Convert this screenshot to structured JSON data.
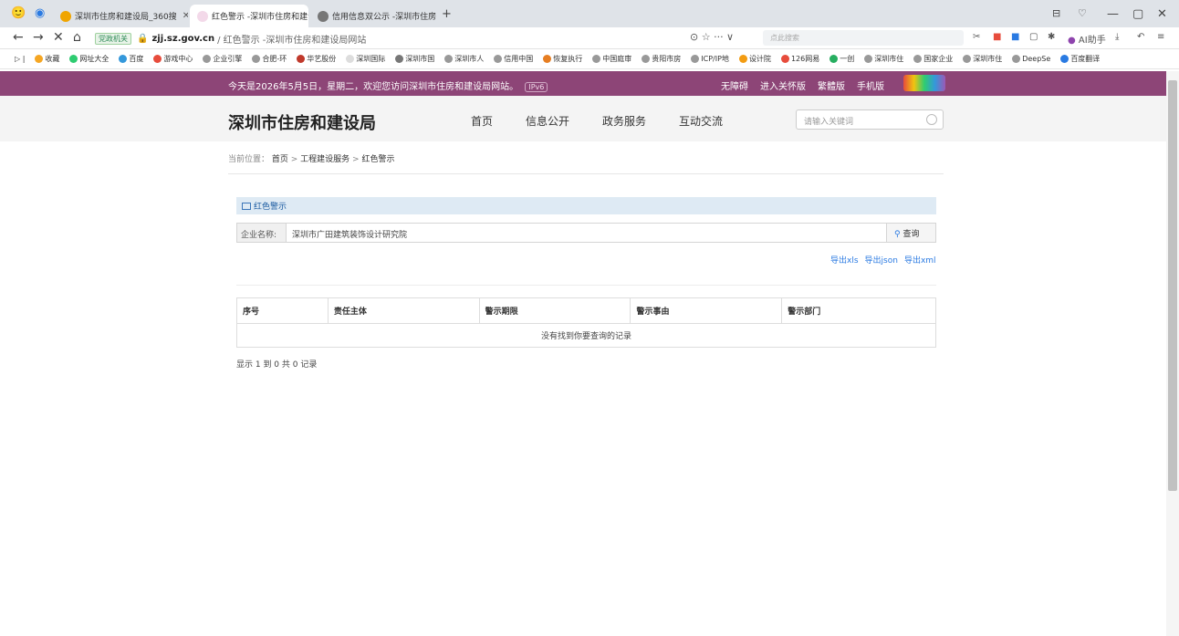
{
  "browser": {
    "tabs": [
      {
        "label": "深圳市住房和建设局_360搜",
        "active": false
      },
      {
        "label": "红色警示 -深圳市住房和建设",
        "active": true
      },
      {
        "label": "信用信息双公示 -深圳市住房",
        "active": false
      }
    ],
    "gov_badge": "党政机关",
    "url_host": "zjj.sz.gov.cn",
    "url_path": "/ 红色警示 -深圳市住房和建设局网站",
    "url_icons": "⊙ ☆ ··· ∨",
    "search_placeholder": "点此搜索",
    "right_label": "AI助手",
    "window_controls": [
      "—",
      "▢",
      "✕"
    ],
    "bookmarks": [
      "收藏",
      "网址大全",
      "百度",
      "游戏中心",
      "企业引擎",
      "合肥-环",
      "华艺股份",
      "深圳国际",
      "深圳市国",
      "深圳市人",
      "信用中国",
      "恢复执行",
      "中国庭审",
      "贵阳市房",
      "ICP/IP地",
      "设计院",
      "126网易",
      "一创",
      "深圳市住",
      "国家企业",
      "深圳市住",
      "DeepSe",
      "百度翻译"
    ]
  },
  "site": {
    "welcome": "今天是2026年5月5日，星期二，欢迎您访问深圳市住房和建设局网站。",
    "ipv6": "IPv6",
    "top_links": [
      "无障碍",
      "进入关怀版",
      "繁體版",
      "手机版"
    ],
    "name": "深圳市住房和建设局",
    "nav": [
      "首页",
      "信息公开",
      "政务服务",
      "互动交流"
    ],
    "search_placeholder": "请输入关键词"
  },
  "breadcrumb": {
    "prefix": "当前位置：",
    "items": [
      "首页",
      "工程建设服务",
      "红色警示"
    ]
  },
  "panel": {
    "title": "红色警示",
    "query_label": "企业名称:",
    "query_value": "深圳市广田建筑装饰设计研究院",
    "query_button": "查询",
    "exports": [
      "导出xls",
      "导出json",
      "导出xml"
    ]
  },
  "table": {
    "headers": [
      "序号",
      "责任主体",
      "警示期限",
      "警示事由",
      "警示部门"
    ],
    "empty_message": "没有找到你要查询的记录",
    "page_info": "显示 1 到 0 共 0 记录"
  }
}
